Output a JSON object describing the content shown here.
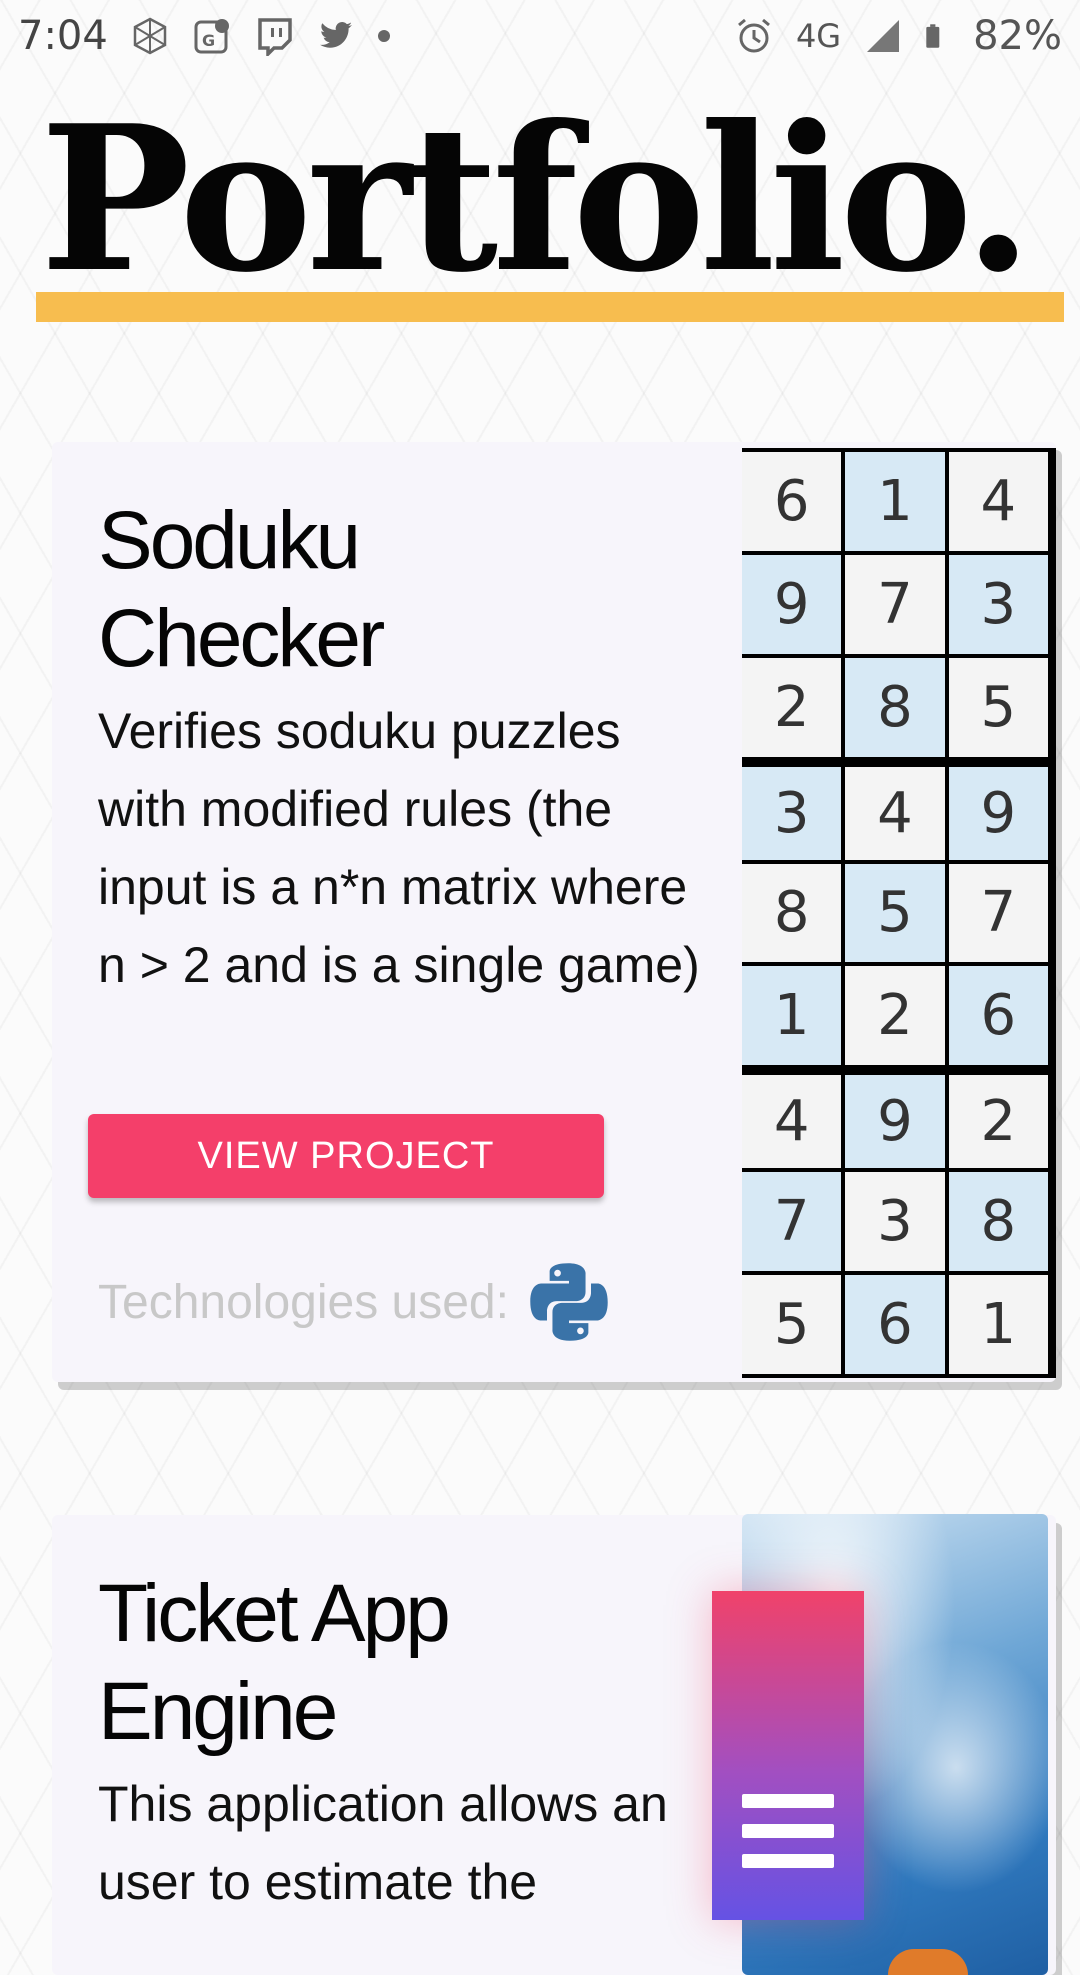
{
  "status_bar": {
    "time": "7:04",
    "network": "4G",
    "battery": "82%",
    "icons": [
      "network-graph-icon",
      "google-maps-icon",
      "twitch-icon",
      "twitter-icon",
      "notification-dot-icon",
      "alarm-icon",
      "signal-icon",
      "battery-icon"
    ]
  },
  "page": {
    "title": "Portfolio.",
    "accent_color": "#f7bd4f"
  },
  "projects": [
    {
      "title_line1": "Soduku",
      "title_line2": "Checker",
      "description": "Verifies soduku puzzles with modified rules (the input is a n*n matrix where n > 2 and is a single game)",
      "button_label": "VIEW PROJECT",
      "button_color": "#f43f6a",
      "technologies_label": "Technologies used:",
      "technology_icons": [
        "python-icon"
      ],
      "image_grid": [
        [
          "6",
          "1",
          "4"
        ],
        [
          "9",
          "7",
          "3"
        ],
        [
          "2",
          "8",
          "5"
        ],
        [
          "3",
          "4",
          "9"
        ],
        [
          "8",
          "5",
          "7"
        ],
        [
          "1",
          "2",
          "6"
        ],
        [
          "4",
          "9",
          "2"
        ],
        [
          "7",
          "3",
          "8"
        ],
        [
          "5",
          "6",
          "1"
        ]
      ]
    },
    {
      "title_line1": "Ticket App",
      "title_line2": "Engine",
      "description": "This application allows an user to estimate the"
    }
  ],
  "menu": {
    "icon": "hamburger-menu-icon"
  }
}
